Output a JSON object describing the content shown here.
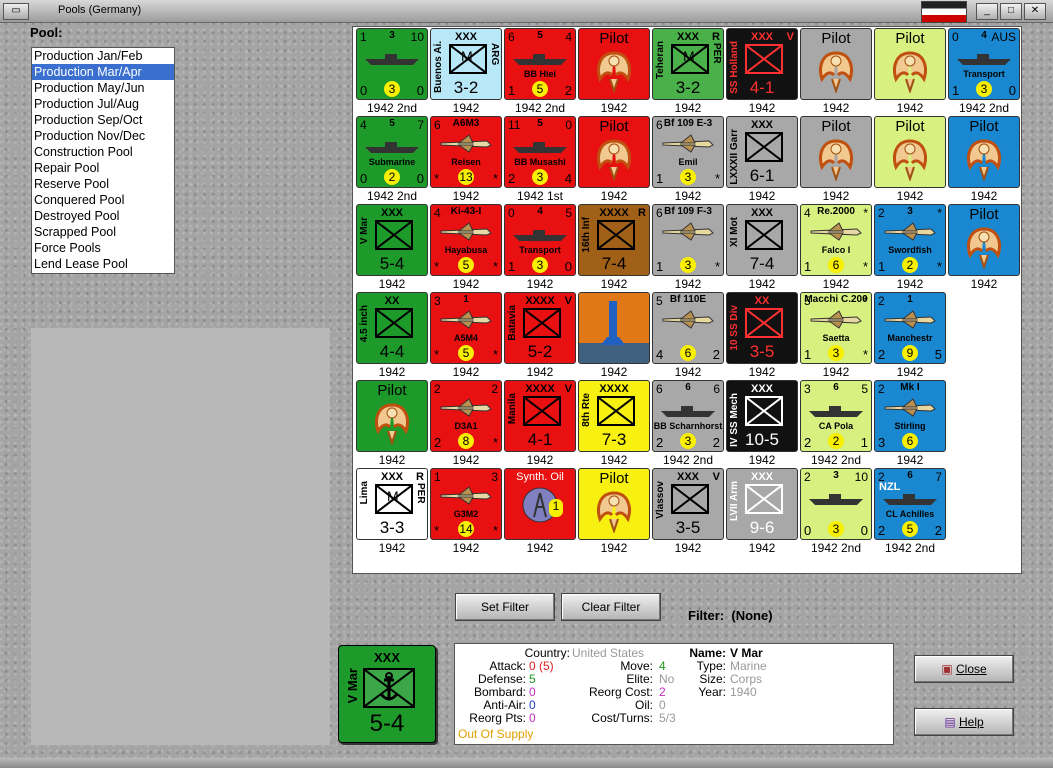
{
  "window": {
    "title": "Pools (Germany)",
    "min": "_",
    "max": "□",
    "close": "✕"
  },
  "pool_label": "Pool:",
  "pool_items": [
    "Production Jan/Feb",
    "Production Mar/Apr",
    "Production May/Jun",
    "Production Jul/Aug",
    "Production Sep/Oct",
    "Production Nov/Dec",
    "Construction Pool",
    "Repair Pool",
    "Reserve Pool",
    "Conquered Pool",
    "Destroyed Pool",
    "Scrapped Pool",
    "Force Pools",
    "Lend Lease Pool"
  ],
  "pool_selected": 1,
  "counters": [
    {
      "bg": "#1d9a2a",
      "kind": "ship",
      "tl": "1",
      "tm": "3",
      "tr": "10",
      "bl": "0",
      "bm": "3",
      "br": "0",
      "year": "1942 2nd"
    },
    {
      "bg": "#b8e8f8",
      "kind": "unit",
      "side": "Buenos Ai.",
      "side_r": "ARG",
      "tm": "XXX",
      "mid": "M",
      "bigv": "3-2",
      "year": "1942"
    },
    {
      "bg": "#e81010",
      "kind": "ship",
      "tl": "6",
      "tm": "5",
      "tr": "4",
      "name": "BB Hiei",
      "bl": "1",
      "bm": "5",
      "br": "2",
      "year": "1942 2nd"
    },
    {
      "bg": "#e81010",
      "kind": "pilot",
      "pilot": "Pilot",
      "year": "1942"
    },
    {
      "bg": "#4ab04a",
      "kind": "unit",
      "side": "Teheran",
      "side_r": "PER",
      "tm": "XXX",
      "tr": "R",
      "mid": "M",
      "bigv": "3-2",
      "year": "1942"
    },
    {
      "bg": "#111111",
      "kind": "unit",
      "side": "SS Holland",
      "tm": "XXX",
      "tr": "V",
      "bigv": "4-1",
      "fg": "#ff3030",
      "year": "1942"
    },
    {
      "bg": "#a8a8a8",
      "kind": "pilot",
      "pilot": "Pilot",
      "year": "1942"
    },
    {
      "bg": "#d8f080",
      "kind": "pilot",
      "pilot": "Pilot",
      "year": "1942"
    },
    {
      "bg": "#1a88d0",
      "kind": "ship",
      "tl": "0",
      "tm": "4",
      "tr": "AUS",
      "name": "Transport",
      "bl": "1",
      "bm": "3",
      "br": "0",
      "year": "1942 2nd"
    },
    {
      "bg": "#1d9a2a",
      "kind": "ship",
      "tl": "4",
      "tm": "5",
      "tr": "7",
      "name": "Submarine",
      "bl": "0",
      "bm": "2",
      "br": "0",
      "year": "1942 2nd"
    },
    {
      "bg": "#e81010",
      "kind": "plane",
      "tl": "6",
      "tm": "A6M3",
      "name": "Reisen",
      "bl": "*",
      "bm": "13",
      "br": "*",
      "year": "1942"
    },
    {
      "bg": "#e81010",
      "kind": "ship",
      "tl": "11",
      "tm": "5",
      "tr": "0",
      "name": "BB Musashi",
      "bl": "2",
      "bm": "3",
      "br": "4",
      "year": "1942 1st"
    },
    {
      "bg": "#e81010",
      "kind": "pilot",
      "pilot": "Pilot",
      "year": "1942"
    },
    {
      "bg": "#a8a8a8",
      "kind": "plane",
      "tl": "6",
      "tm": "Bf 109 E-3",
      "name": "Emil",
      "bl": "1",
      "bm": "3",
      "br": "*",
      "year": "1942"
    },
    {
      "bg": "#a8a8a8",
      "kind": "unit",
      "side": "LXXXII Garr",
      "tm": "XXX",
      "bigv": "6-1",
      "year": "1942"
    },
    {
      "bg": "#a8a8a8",
      "kind": "pilot",
      "pilot": "Pilot",
      "year": "1942"
    },
    {
      "bg": "#d8f080",
      "kind": "pilot",
      "pilot": "Pilot",
      "year": "1942"
    },
    {
      "bg": "#1a88d0",
      "kind": "pilot",
      "pilot": "Pilot",
      "year": "1942"
    },
    {
      "bg": "#1d9a2a",
      "kind": "unit",
      "side": "V Mar",
      "tm": "XXX",
      "bigv": "5-4",
      "year": "1942"
    },
    {
      "bg": "#e81010",
      "kind": "plane",
      "tl": "4",
      "tm": "Ki-43-I",
      "name": "Hayabusa",
      "bl": "*",
      "bm": "5",
      "br": "*",
      "year": "1942"
    },
    {
      "bg": "#e81010",
      "kind": "ship",
      "tl": "0",
      "tm": "4",
      "tr": "5",
      "name": "Transport",
      "bl": "1",
      "bm": "3",
      "br": "0",
      "year": "1942"
    },
    {
      "bg": "#a06018",
      "kind": "unit",
      "side": "16th Inf",
      "tm": "XXXX",
      "tr": "R",
      "bigv": "7-4",
      "year": "1942"
    },
    {
      "bg": "#a8a8a8",
      "kind": "plane",
      "tl": "6",
      "tm": "Bf 109 F-3",
      "bl": "1",
      "bm": "3",
      "br": "*",
      "year": "1942"
    },
    {
      "bg": "#a8a8a8",
      "kind": "unit",
      "side": "XI Mot",
      "tm": "XXX",
      "bigv": "7-4",
      "year": "1942"
    },
    {
      "bg": "#d8f080",
      "kind": "plane",
      "tl": "4",
      "tm": "Re.2000",
      "tr": "*",
      "name": "Falco I",
      "bl": "1",
      "bm": "6",
      "br": "*",
      "year": "1942"
    },
    {
      "bg": "#1a88d0",
      "kind": "plane",
      "tl": "2",
      "tm": "3",
      "tr": "*",
      "name": "Swordfish",
      "bl": "1",
      "bm": "2",
      "br": "*",
      "year": "1942"
    },
    {
      "bg": "#1a88d0",
      "kind": "pilot",
      "pilot": "Pilot",
      "year": "1942"
    },
    {
      "bg": "#1d9a2a",
      "kind": "unit",
      "side": "4.5 inch",
      "tm": "XX",
      "bigv": "4-4",
      "year": "1942"
    },
    {
      "bg": "#e81010",
      "kind": "plane",
      "tl": "3",
      "tm": "1",
      "name": "A5M4",
      "bl": "*",
      "bm": "5",
      "br": "*",
      "year": "1942"
    },
    {
      "bg": "#e81010",
      "kind": "unit",
      "side": "Batavia",
      "tm": "XXXX",
      "tr": "V",
      "bigv": "5-2",
      "year": "1942"
    },
    {
      "bg": "#e07818",
      "kind": "factory",
      "year": "1942"
    },
    {
      "bg": "#a8a8a8",
      "kind": "plane",
      "tl": "5",
      "tm": "Bf 110E",
      "bl": "4",
      "bm": "6",
      "br": "2",
      "year": "1942"
    },
    {
      "bg": "#111111",
      "kind": "unit",
      "side": "10 SS Div",
      "tm": "XX",
      "bigv": "3-5",
      "fg": "#ff3030",
      "year": "1942"
    },
    {
      "bg": "#d8f080",
      "kind": "plane",
      "tl": "5",
      "tm": "Macchi C.200",
      "tr": "*",
      "name": "Saetta",
      "bl": "1",
      "bm": "3",
      "br": "*",
      "year": "1942"
    },
    {
      "bg": "#1a88d0",
      "kind": "plane",
      "tl": "2",
      "tm": "1",
      "name": "Manchestr",
      "bl": "2",
      "bm": "9",
      "br": "5",
      "year": "1942"
    },
    {
      "bg": "",
      "kind": "empty",
      "year": ""
    },
    {
      "bg": "#1d9a2a",
      "kind": "pilot",
      "pilot": "Pilot",
      "year": "1942"
    },
    {
      "bg": "#e81010",
      "kind": "plane",
      "tl": "2",
      "tr": "2",
      "name": "D3A1",
      "bl": "2",
      "bm": "8",
      "br": "*",
      "year": "1942"
    },
    {
      "bg": "#e81010",
      "kind": "unit",
      "side": "Manila",
      "tm": "XXXX",
      "tr": "V",
      "bigv": "4-1",
      "year": "1942"
    },
    {
      "bg": "#f8f010",
      "kind": "unit",
      "side": "8th Rte",
      "tm": "XXXX",
      "bigv": "7-3",
      "year": "1942"
    },
    {
      "bg": "#a8a8a8",
      "kind": "ship",
      "tl": "6",
      "tm": "6",
      "tr": "6",
      "name": "BB Scharnhorst",
      "bl": "2",
      "bm": "3",
      "br": "2",
      "year": "1942 2nd"
    },
    {
      "bg": "#111111",
      "kind": "unit",
      "side": "IV SS Mech",
      "tm": "XXX",
      "bigv": "10-5",
      "fg": "#ffffff",
      "year": "1942"
    },
    {
      "bg": "#d8f080",
      "kind": "ship",
      "tl": "3",
      "tm": "6",
      "tr": "5",
      "name": "CA Pola",
      "bl": "2",
      "bm": "2",
      "br": "1",
      "year": "1942 2nd"
    },
    {
      "bg": "#1a88d0",
      "kind": "plane",
      "tl": "2",
      "tm": "Mk I",
      "name": "Stirling",
      "bl": "3",
      "bm": "6",
      "br": "",
      "year": "1942"
    },
    {
      "bg": "",
      "kind": "empty",
      "year": ""
    },
    {
      "bg": "#ffffff",
      "kind": "unit",
      "side": "Lima",
      "side_r": "PER",
      "tm": "XXX",
      "tr": "R",
      "mid": "M",
      "bigv": "3-3",
      "fg": "#000",
      "year": "1942"
    },
    {
      "bg": "#e81010",
      "kind": "plane",
      "tl": "1",
      "tr": "3",
      "name": "G3M2",
      "bl": "*",
      "bm": "14",
      "br": "*",
      "year": "1942"
    },
    {
      "bg": "#e81010",
      "kind": "oil",
      "tm": "Synth. Oil",
      "bm": "1",
      "year": "1942"
    },
    {
      "bg": "#f8f010",
      "kind": "pilot",
      "pilot": "Pilot",
      "year": "1942"
    },
    {
      "bg": "#a8a8a8",
      "kind": "unit",
      "side": "Vlassov",
      "tm": "XXX",
      "tr": "V",
      "bigv": "3-5",
      "year": "1942"
    },
    {
      "bg": "#a8a8a8",
      "kind": "unit",
      "side": "LVII Arm",
      "tm": "XXX",
      "bigv": "9-6",
      "fg": "#ffffff",
      "year": "1942"
    },
    {
      "bg": "#d8f080",
      "kind": "ship",
      "tl": "2",
      "tm": "3",
      "tr": "10",
      "bl": "0",
      "bm": "3",
      "br": "0",
      "year": "1942 2nd"
    },
    {
      "bg": "#1a88d0",
      "kind": "ship",
      "tl": "2",
      "tm": "6",
      "tr": "7",
      "name": "CL Achilles",
      "side_r": "NZL",
      "bl": "2",
      "bm": "5",
      "br": "2",
      "year": "1942 2nd"
    }
  ],
  "buttons": {
    "set_filter": "Set Filter",
    "clear_filter": "Clear Filter",
    "close": "Close",
    "help": "Help"
  },
  "filter": {
    "label": "Filter:",
    "value": "(None)"
  },
  "selected": {
    "tm": "XXX",
    "side": "V Mar",
    "value": "5-4"
  },
  "details": {
    "country_l": "Country:",
    "country_v": "United States",
    "attack_l": "Attack:",
    "attack_v": "0 (5)",
    "defense_l": "Defense:",
    "defense_v": "5",
    "bombard_l": "Bombard:",
    "bombard_v": "0",
    "antiair_l": "Anti-Air:",
    "antiair_v": "0",
    "reorgpts_l": "Reorg Pts:",
    "reorgpts_v": "0",
    "supply": "Out Of Supply",
    "move_l": "Move:",
    "move_v": "4",
    "elite_l": "Elite:",
    "elite_v": "No",
    "reorgcost_l": "Reorg Cost:",
    "reorgcost_v": "2",
    "oil_l": "Oil:",
    "oil_v": "0",
    "costturns_l": "Cost/Turns:",
    "costturns_v": "5/3",
    "name_l": "Name:",
    "name_v": "V Mar",
    "type_l": "Type:",
    "type_v": "Marine",
    "size_l": "Size:",
    "size_v": "Corps",
    "year_l": "Year:",
    "year_v": "1940"
  },
  "colors": {
    "attack": "#e02020",
    "defense": "#1a9a1a",
    "bombard": "#c030c0",
    "antiair": "#2040c0",
    "supply": "#e0a000",
    "grey": "#999999"
  }
}
